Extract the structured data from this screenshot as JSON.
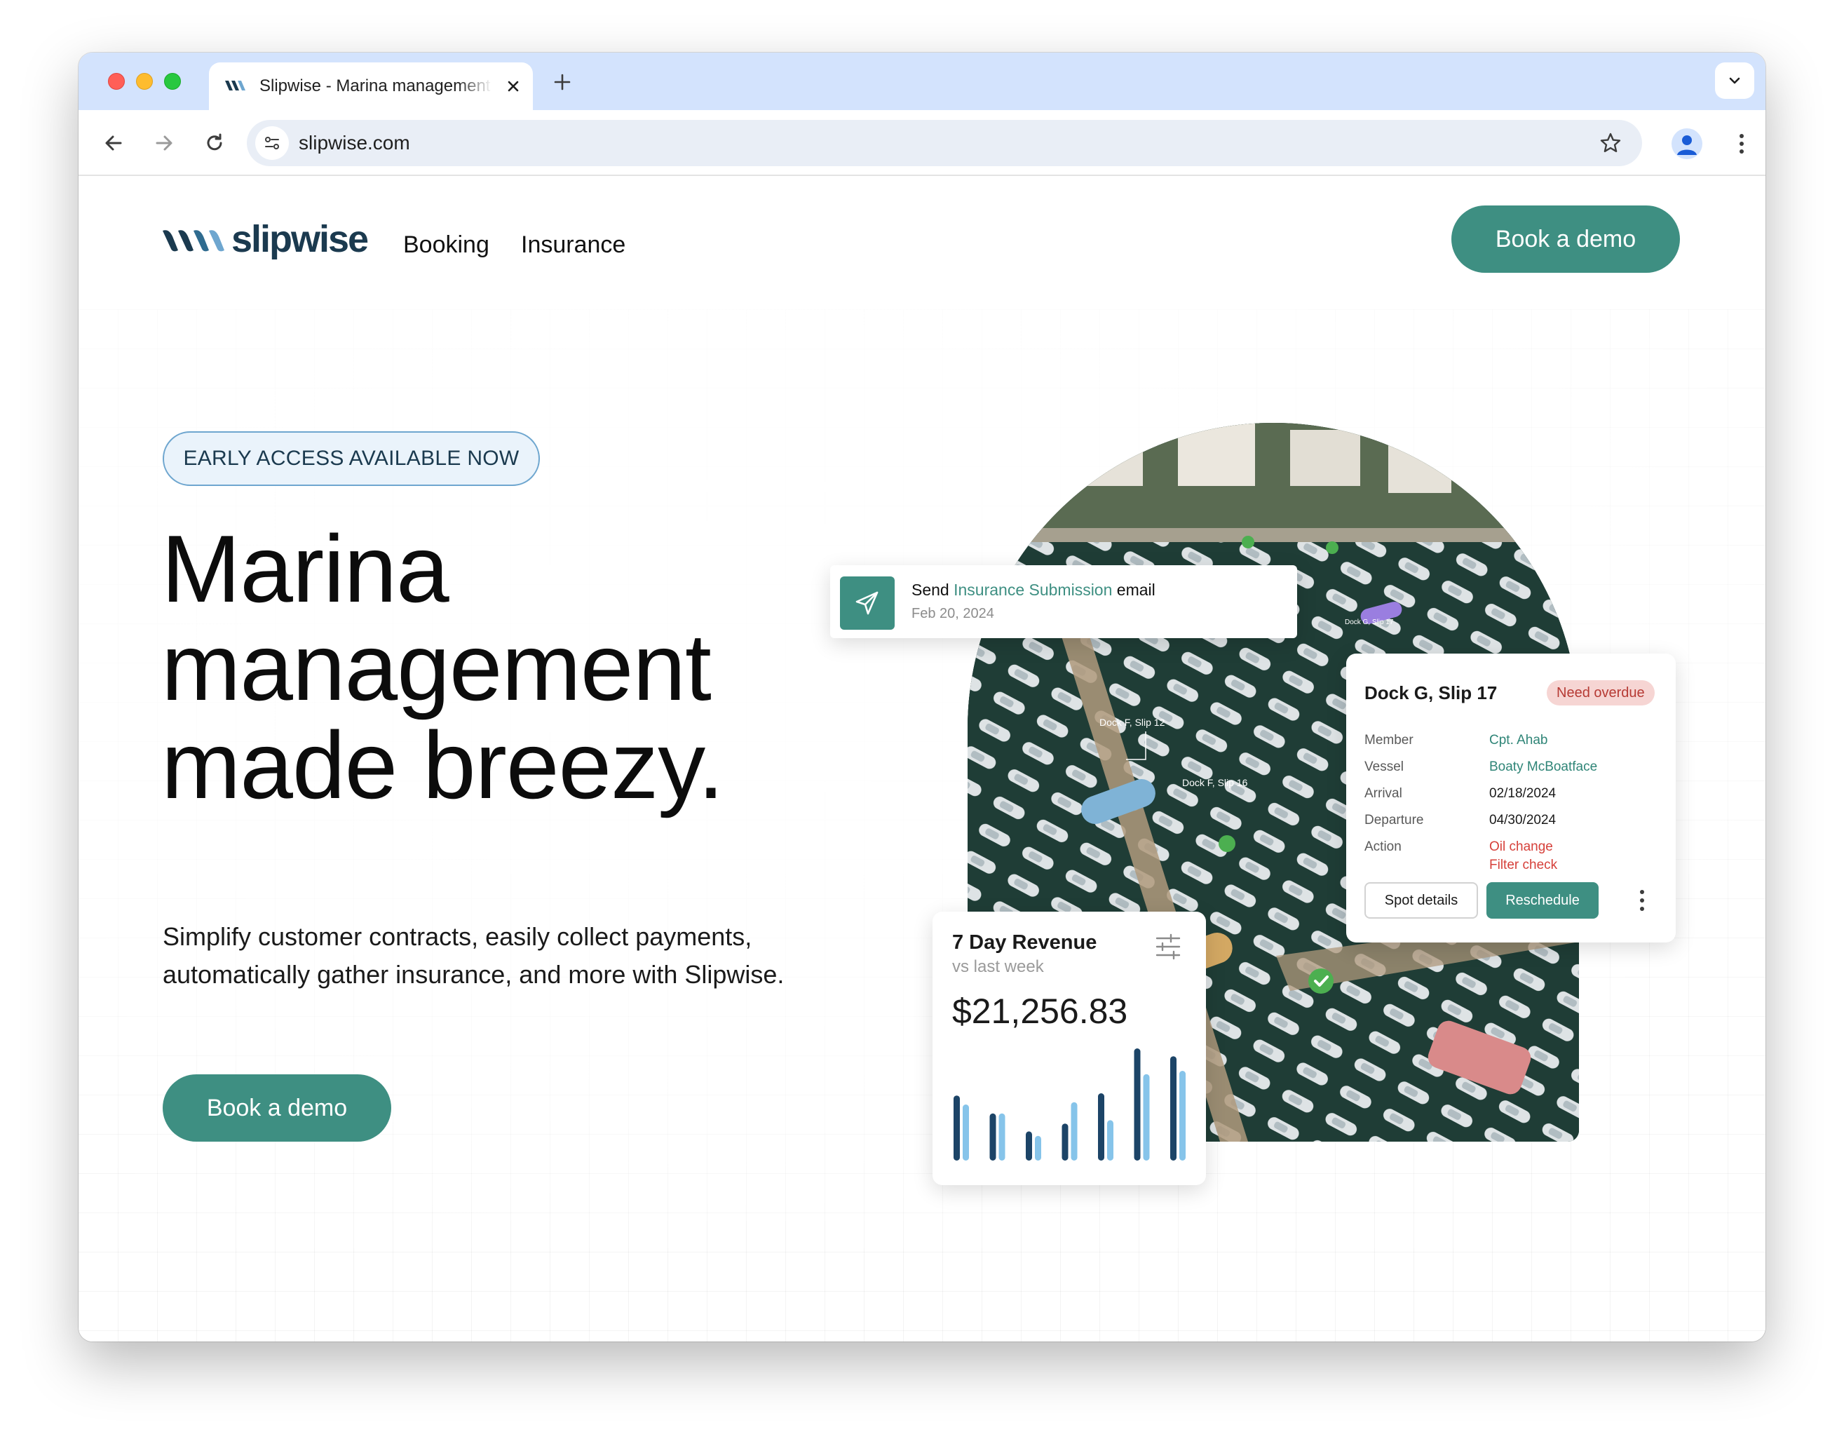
{
  "browser": {
    "tab_title": "Slipwise - Marina management",
    "url": "slipwise.com"
  },
  "site": {
    "logo_text": "slipwise",
    "nav": [
      "Booking",
      "Insurance"
    ],
    "header_cta": "Book a demo"
  },
  "hero": {
    "badge": "EARLY ACCESS AVAILABLE NOW",
    "title_lines": [
      "Marina",
      "management",
      "made breezy."
    ],
    "subtitle": "Simplify customer contracts, easily collect payments, automatically gather insurance, and more with Slipwise.",
    "cta": "Book a demo"
  },
  "photo_labels": [
    "Dock F, Slip 12",
    "Dock F, Slip 16",
    "Dock G, Slip 17"
  ],
  "email_card": {
    "prefix": "Send ",
    "highlight": "Insurance Submission",
    "suffix": " email",
    "date": "Feb 20, 2024"
  },
  "slip_card": {
    "title": "Dock G, Slip 17",
    "status": "Need overdue",
    "rows": [
      {
        "label": "Member",
        "value": "Cpt. Ahab"
      },
      {
        "label": "Vessel",
        "value": "Boaty McBoatface"
      },
      {
        "label": "Arrival",
        "value": "02/18/2024"
      },
      {
        "label": "Departure",
        "value": "04/30/2024"
      },
      {
        "label": "Action",
        "values": [
          "Oil change",
          "Filter check"
        ]
      }
    ],
    "buttons": {
      "details": "Spot details",
      "reschedule": "Reschedule"
    }
  },
  "revenue_card": {
    "title": "7 Day Revenue",
    "subtitle": "vs last week",
    "value": "$21,256.83"
  },
  "colors": {
    "brand_teal": "#3e8f82",
    "brand_navy": "#1b3a4f",
    "bar_current": "#1c4467",
    "bar_previous": "#86c4ea",
    "badge_border": "#6ea6cf",
    "status_bg": "#f6d5d3",
    "status_text": "#b63a34"
  },
  "chart_data": {
    "type": "bar",
    "categories": [
      "1",
      "2",
      "3",
      "4",
      "5",
      "6",
      "7"
    ],
    "series": [
      {
        "values": [
          0.58,
          0.42,
          0.26,
          0.33,
          0.6,
          1.0,
          0.93
        ]
      },
      {
        "values": [
          0.5,
          0.42,
          0.22,
          0.52,
          0.36,
          0.77,
          0.8
        ]
      }
    ],
    "ylim": [
      0,
      1
    ],
    "grid": false
  }
}
